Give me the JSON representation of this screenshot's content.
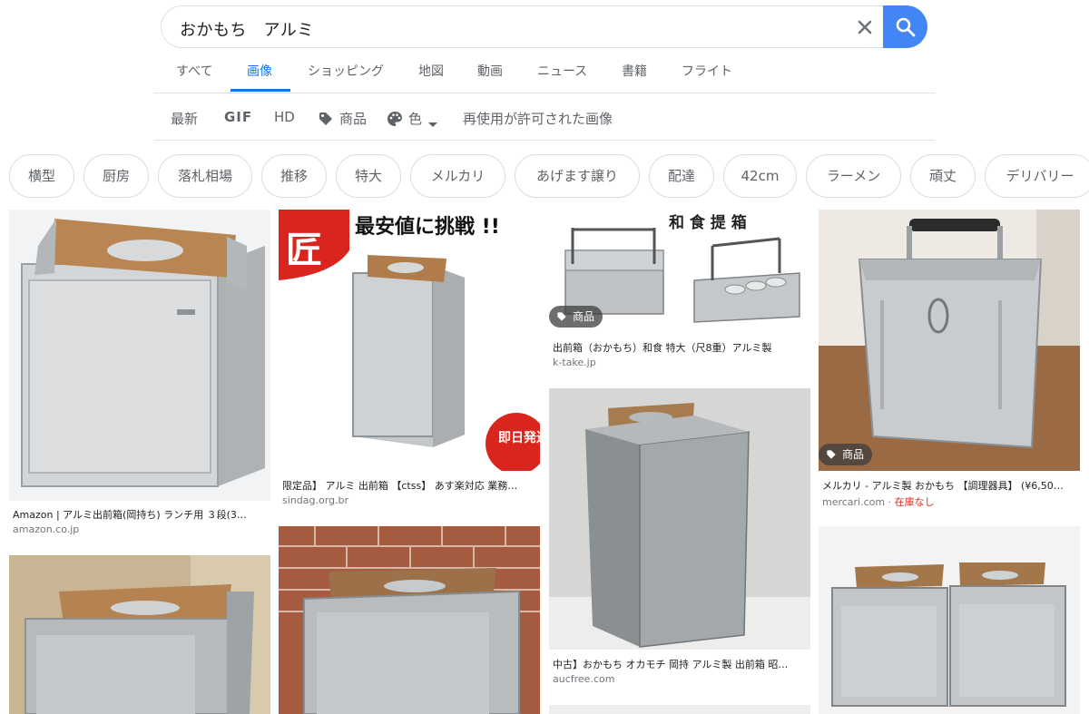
{
  "search": {
    "query": "おかもち　アルミ"
  },
  "tabs": [
    {
      "label": "すべて"
    },
    {
      "label": "画像"
    },
    {
      "label": "ショッピング"
    },
    {
      "label": "地図"
    },
    {
      "label": "動画"
    },
    {
      "label": "ニュース"
    },
    {
      "label": "書籍"
    },
    {
      "label": "フライト"
    }
  ],
  "active_tab": "画像",
  "tools": {
    "newest": "最新",
    "gif": "GIF",
    "hd": "HD",
    "product": "商品",
    "color": "色",
    "license": "再使用が許可された画像"
  },
  "chips": [
    {
      "label": "横型"
    },
    {
      "label": "厨房"
    },
    {
      "label": "落札相場"
    },
    {
      "label": "推移"
    },
    {
      "label": "特大"
    },
    {
      "label": "メルカリ"
    },
    {
      "label": "あげます譲り"
    },
    {
      "label": "配達"
    },
    {
      "label": "42cm"
    },
    {
      "label": "ラーメン"
    },
    {
      "label": "頑丈"
    },
    {
      "label": "デリバリー"
    }
  ],
  "results": [
    {
      "title": "Amazon | アルミ出前箱(岡持ち) ランチ用 ３段(3…",
      "source": "amazon.co.jp"
    },
    {
      "title": "限定品】 アルミ 出前箱 【ctss】 あす楽対応 業務…",
      "source": "sindag.org.br",
      "overlay_text": "最安値に挑戦 !!",
      "seal_text": "匠",
      "corner_text": "即日発送"
    },
    {
      "title": "出前箱（おかもち）和食 特大（尺8重）アルミ製",
      "source": "k-take.jp",
      "badge": "商品",
      "overlay_text": "和 食 提 箱"
    },
    {
      "title": "メルカリ - アルミ製 おかもち 【調理器具】 (¥6,50…",
      "source": "mercari.com",
      "source_extra": "在庫なし",
      "badge": "商品"
    },
    {
      "title": "中古】おかもち オカモチ 岡持 アルミ製 出前箱 昭…",
      "source": "aucfree.com"
    }
  ],
  "colors": {
    "accent": "#1a73e8",
    "search_button": "#4285f4",
    "out_of_stock": "#d93025"
  }
}
